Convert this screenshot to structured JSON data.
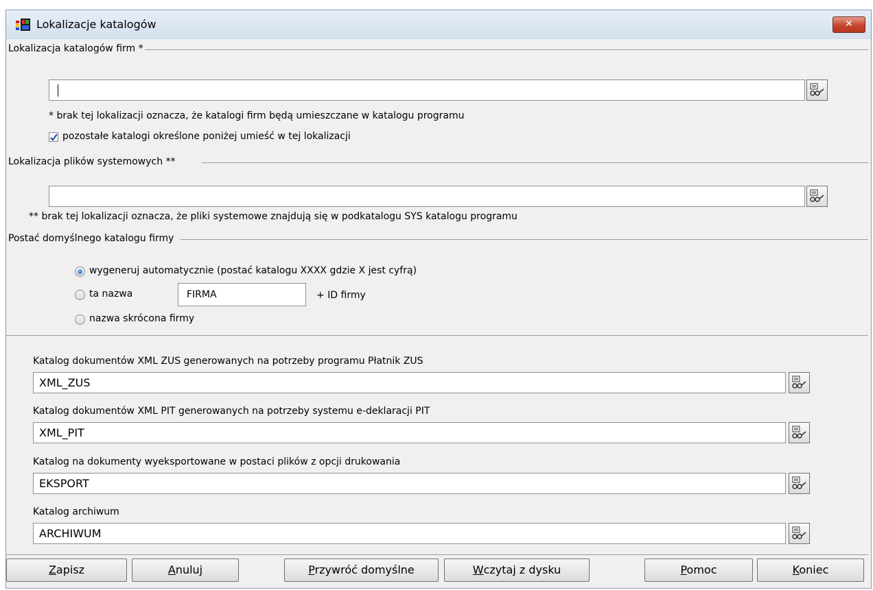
{
  "window": {
    "title": "Lokalizacje katalogów",
    "close_label": "✕"
  },
  "firm_catalog_group": {
    "title": "Lokalizacja katalogów firm *",
    "path_value": "",
    "note": "* brak tej lokalizacji oznacza, że katalogi firm będą umieszczane w katalogu programu",
    "checkbox_label": "pozostałe katalogi określone poniżej umieść w tej lokalizacji",
    "checkbox_checked": true
  },
  "system_files_group": {
    "title": "Lokalizacja plików systemowych **",
    "path_value": "",
    "note": "** brak tej lokalizacji oznacza, że pliki systemowe znajdują się w podkatalogu SYS katalogu programu"
  },
  "default_firm_catalog_group": {
    "title": "Postać domyślnego katalogu firmy",
    "options": [
      {
        "label": "wygeneruj automatycznie (postać katalogu XXXX gdzie X jest cyfrą)",
        "selected": true
      },
      {
        "label": "ta nazwa",
        "selected": false
      },
      {
        "label": "nazwa skrócona firmy",
        "selected": false
      }
    ],
    "name_value": "FIRMA",
    "id_suffix": "+ ID firmy"
  },
  "catalogs": [
    {
      "label": "Katalog dokumentów XML ZUS generowanych na potrzeby programu Płatnik ZUS",
      "value": "XML_ZUS"
    },
    {
      "label": "Katalog dokumentów XML PIT generowanych na potrzeby systemu e-deklaracji PIT",
      "value": "XML_PIT"
    },
    {
      "label": "Katalog na dokumenty wyeksportowane w postaci plików z opcji drukowania",
      "value": "EKSPORT"
    },
    {
      "label": "Katalog archiwum",
      "value": "ARCHIWUM"
    }
  ],
  "buttons": {
    "save": {
      "accel": "Z",
      "rest": "apisz"
    },
    "cancel": {
      "accel": "A",
      "rest": "nuluj"
    },
    "restore": {
      "accel": "P",
      "rest": "rzywróć domyślne"
    },
    "load": {
      "accel": "W",
      "rest": "czytaj z dysku"
    },
    "help": {
      "accel": "P",
      "rest": "omoc"
    },
    "end": {
      "accel": "K",
      "rest": "oniec"
    }
  },
  "colors": {
    "title_bar": "#dce6f2",
    "close_button": "#c5452c",
    "background": "#f0f0f0"
  },
  "icons": [
    "app-icon",
    "close-icon",
    "browse-folder-icon",
    "checkmark-icon"
  ]
}
